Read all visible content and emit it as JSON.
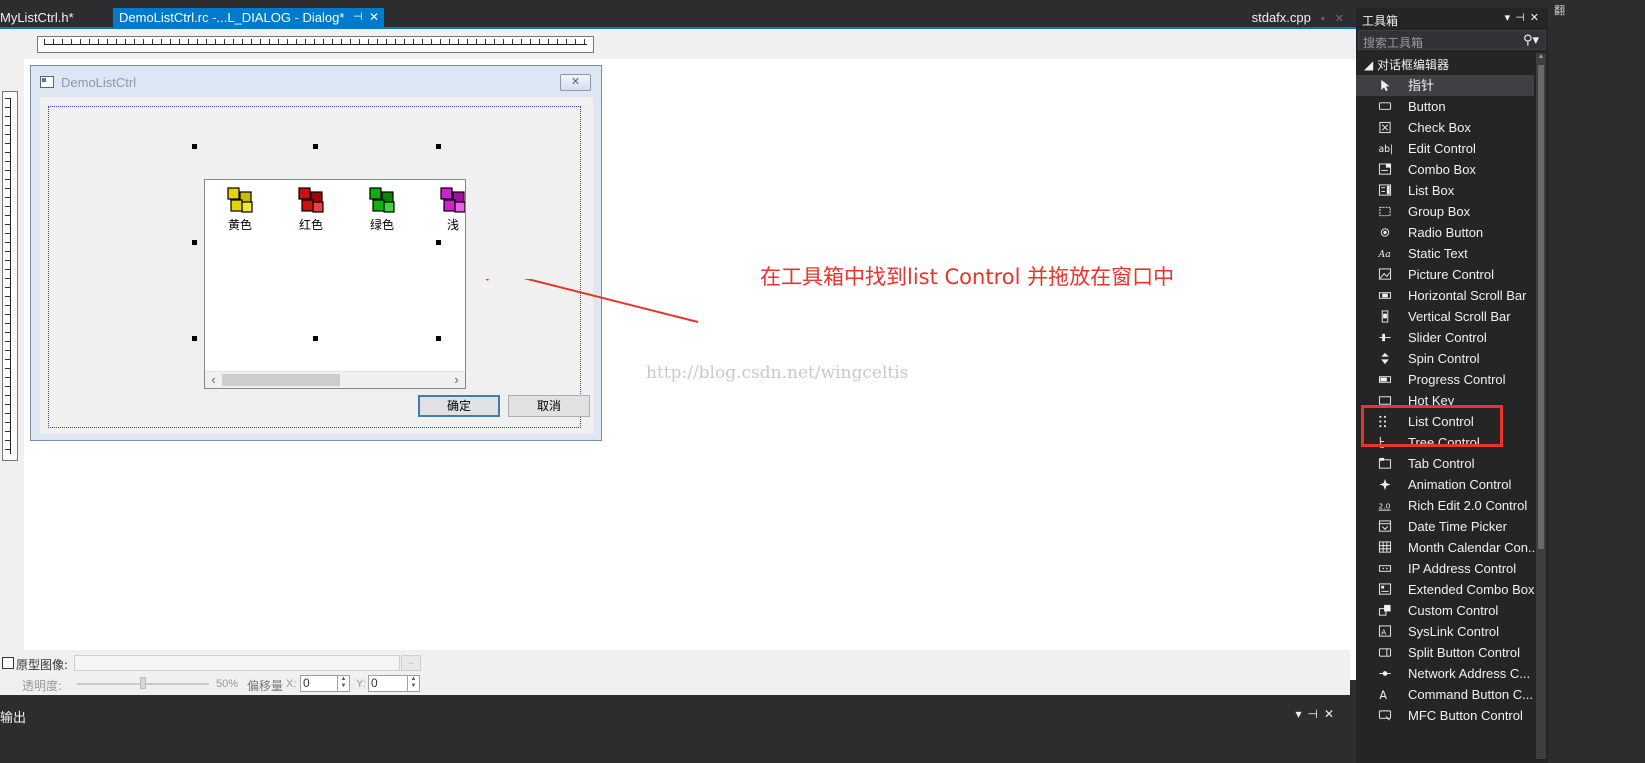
{
  "tabs": {
    "myctrl_h": "MyListCtrl.h*",
    "demo_rc": "DemoListCtrl.rc -...L_DIALOG - Dialog*",
    "stdafx": "stdafx.cpp"
  },
  "dialog": {
    "caption": "DemoListCtrl",
    "list_items": [
      {
        "label": "黄色",
        "color": "#e5d400"
      },
      {
        "label": "红色",
        "color": "#d01010"
      },
      {
        "label": "绿色",
        "color": "#10b010"
      },
      {
        "label": "浅",
        "color": "#d020d0"
      }
    ],
    "ok_label": "确定",
    "cancel_label": "取消"
  },
  "annotation": {
    "text": "在工具箱中找到list Control  并拖放在窗口中",
    "watermark": "http://blog.csdn.net/wingceltis",
    "color": "#e8342b"
  },
  "propbar": {
    "prototype_label": "原型图像:",
    "opacity_label": "透明度:",
    "opacity_value": "50%",
    "offset_label": "偏移量",
    "x_label": "X:",
    "x_value": "0",
    "y_label": "Y:",
    "y_value": "0"
  },
  "output": {
    "title": "输出"
  },
  "toolbox": {
    "title": "工具箱",
    "search_placeholder": "搜索工具箱",
    "group": "对话框编辑器",
    "items": [
      {
        "label": "指针",
        "icon": "pointer-icon"
      },
      {
        "label": "Button",
        "icon": "button-icon"
      },
      {
        "label": "Check Box",
        "icon": "checkbox-icon"
      },
      {
        "label": "Edit Control",
        "icon": "edit-icon"
      },
      {
        "label": "Combo Box",
        "icon": "combobox-icon"
      },
      {
        "label": "List Box",
        "icon": "listbox-icon"
      },
      {
        "label": "Group Box",
        "icon": "groupbox-icon"
      },
      {
        "label": "Radio Button",
        "icon": "radio-icon"
      },
      {
        "label": "Static Text",
        "icon": "static-text-icon"
      },
      {
        "label": "Picture Control",
        "icon": "picture-icon"
      },
      {
        "label": "Horizontal Scroll Bar",
        "icon": "hscroll-icon"
      },
      {
        "label": "Vertical Scroll Bar",
        "icon": "vscroll-icon"
      },
      {
        "label": "Slider Control",
        "icon": "slider-icon"
      },
      {
        "label": "Spin Control",
        "icon": "spin-icon"
      },
      {
        "label": "Progress Control",
        "icon": "progress-icon"
      },
      {
        "label": "Hot Key",
        "icon": "hotkey-icon"
      },
      {
        "label": "List Control",
        "icon": "listctrl-icon"
      },
      {
        "label": "Tree Control",
        "icon": "tree-icon"
      },
      {
        "label": "Tab Control",
        "icon": "tab-icon"
      },
      {
        "label": "Animation Control",
        "icon": "animation-icon"
      },
      {
        "label": "Rich Edit 2.0 Control",
        "icon": "richedit-icon"
      },
      {
        "label": "Date Time Picker",
        "icon": "datetime-icon"
      },
      {
        "label": "Month Calendar Con...",
        "icon": "calendar-icon"
      },
      {
        "label": "IP Address Control",
        "icon": "ipaddress-icon"
      },
      {
        "label": "Extended Combo Box",
        "icon": "excombo-icon"
      },
      {
        "label": "Custom Control",
        "icon": "custom-icon"
      },
      {
        "label": "SysLink Control",
        "icon": "syslink-icon"
      },
      {
        "label": "Split Button Control",
        "icon": "splitbutton-icon"
      },
      {
        "label": "Network Address C...",
        "icon": "netaddress-icon"
      },
      {
        "label": "Command Button C...",
        "icon": "command-icon"
      },
      {
        "label": "MFC Button Control",
        "icon": "mfcbutton-icon"
      }
    ]
  }
}
